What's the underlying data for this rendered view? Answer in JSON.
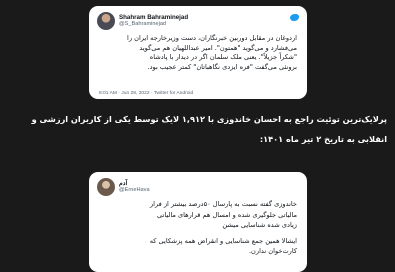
{
  "tweet1": {
    "display_name": "Shahram Bahraminejad",
    "handle": "@S_Bahraminejad",
    "lines": [
      "اردوغان در مقابل دوربین خبرنگاران، دست وزیرخارجه ایران را",
      "می‌فشارد و می‌گوید \"همتون\". امیر عبداللهیان هم می‌گوید",
      "\"شکراً جزیلاً\". یعنی ملک سلمان اگر در دیدار با پادشاه",
      "برونئی می‌گفت \"فره ایزدی نگاهباتان\" کمتر عجیب بود."
    ],
    "meta": "8:01 AM · Jun 28, 2022 · Twitter for Android"
  },
  "caption": {
    "lines": [
      "پرلایک‌ترین توئیت راجع به احسان خاندوزی با ۱,۹۱۲ لایک توسط یکی از کاربران ارزشی و",
      "انقلابی به تاریخ ۲ تیر ماه ۱۴۰۱:"
    ]
  },
  "tweet2": {
    "display_name": "آدم",
    "handle": "@ErneHava",
    "lines": [
      "خاندوزی گفته نسبت به پارسال ۵۰درصد بیشتر از فرار",
      "مالیاتی جلوگیری شده و امسال هم قرارهای مالیاتی",
      "زیادی شده شناسایی میشن"
    ],
    "lines2": [
      "ایشالا همین جمع شناسایی و انقراض همه پزشکایی که",
      "کارت‌خوان ندارن."
    ]
  }
}
